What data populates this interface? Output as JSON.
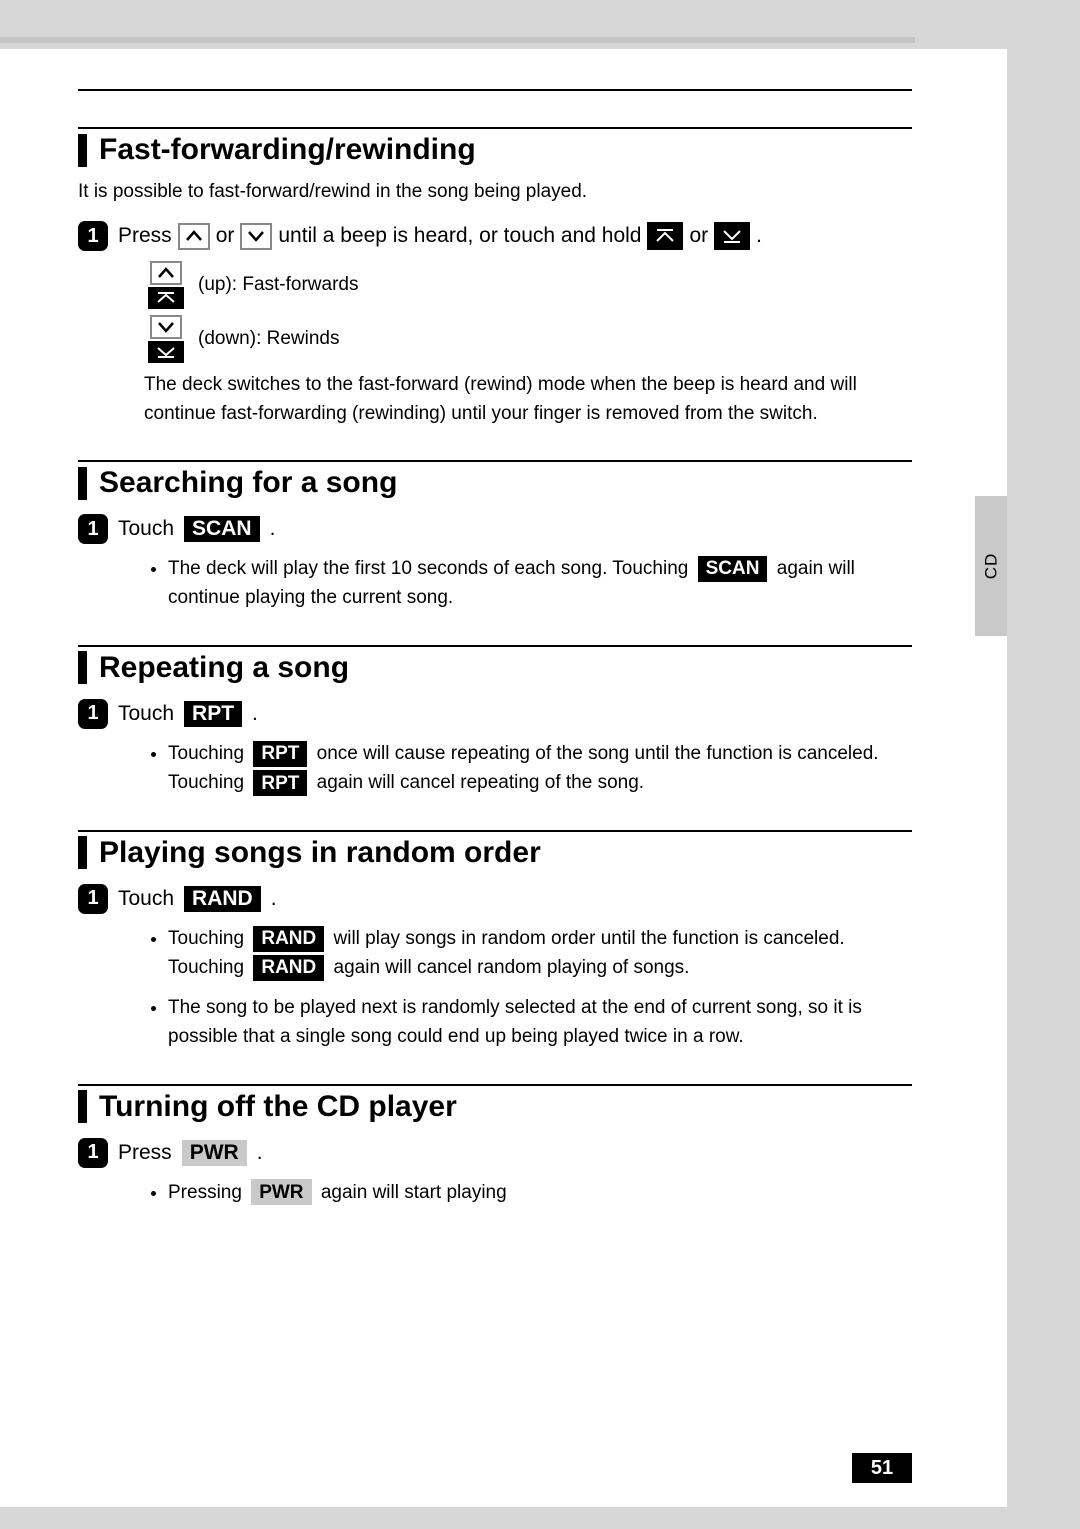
{
  "side_tab": "CD",
  "page_number": "51",
  "sections": {
    "ff": {
      "title": "Fast-forwarding/rewinding",
      "intro": "It is possible to fast-forward/rewind in the song being played.",
      "step_num": "1",
      "step_text_a": "Press",
      "step_text_b": "or",
      "step_text_c": "until a beep is heard, or touch and hold",
      "step_text_d": "or",
      "step_text_e": ".",
      "up_label": "(up): Fast-forwards",
      "down_label": "(down): Rewinds",
      "note": "The deck switches to the fast-forward (rewind) mode when the beep is heard and will continue fast-forwarding (rewinding) until your finger is removed from the switch."
    },
    "search": {
      "title": "Searching for a song",
      "step_num": "1",
      "touch": "Touch",
      "btn": "SCAN",
      "period": ".",
      "bullet_a": "The deck will play the first 10 seconds of each song.  Touching",
      "bullet_b": "again will continue playing the current song."
    },
    "repeat": {
      "title": "Repeating a song",
      "step_num": "1",
      "touch": "Touch",
      "btn": "RPT",
      "period": ".",
      "bullet_a": "Touching",
      "bullet_b": "once will cause repeating of the song until the function is canceled. Touching",
      "bullet_c": "again will cancel repeating of the song."
    },
    "random": {
      "title": "Playing songs in random order",
      "step_num": "1",
      "touch": "Touch",
      "btn": "RAND",
      "period": ".",
      "bullet1_a": "Touching",
      "bullet1_b": "will play songs in random order until the function is canceled. Touching",
      "bullet1_c": "again will cancel random playing of songs.",
      "bullet2": "The song to be played next is randomly selected at the end of current song, so it is possible that a single song could end up being played twice in a row."
    },
    "off": {
      "title": "Turning off the CD player",
      "step_num": "1",
      "press": "Press",
      "btn": "PWR",
      "period": ".",
      "bullet_a": "Pressing",
      "bullet_b": "again will start playing"
    }
  }
}
